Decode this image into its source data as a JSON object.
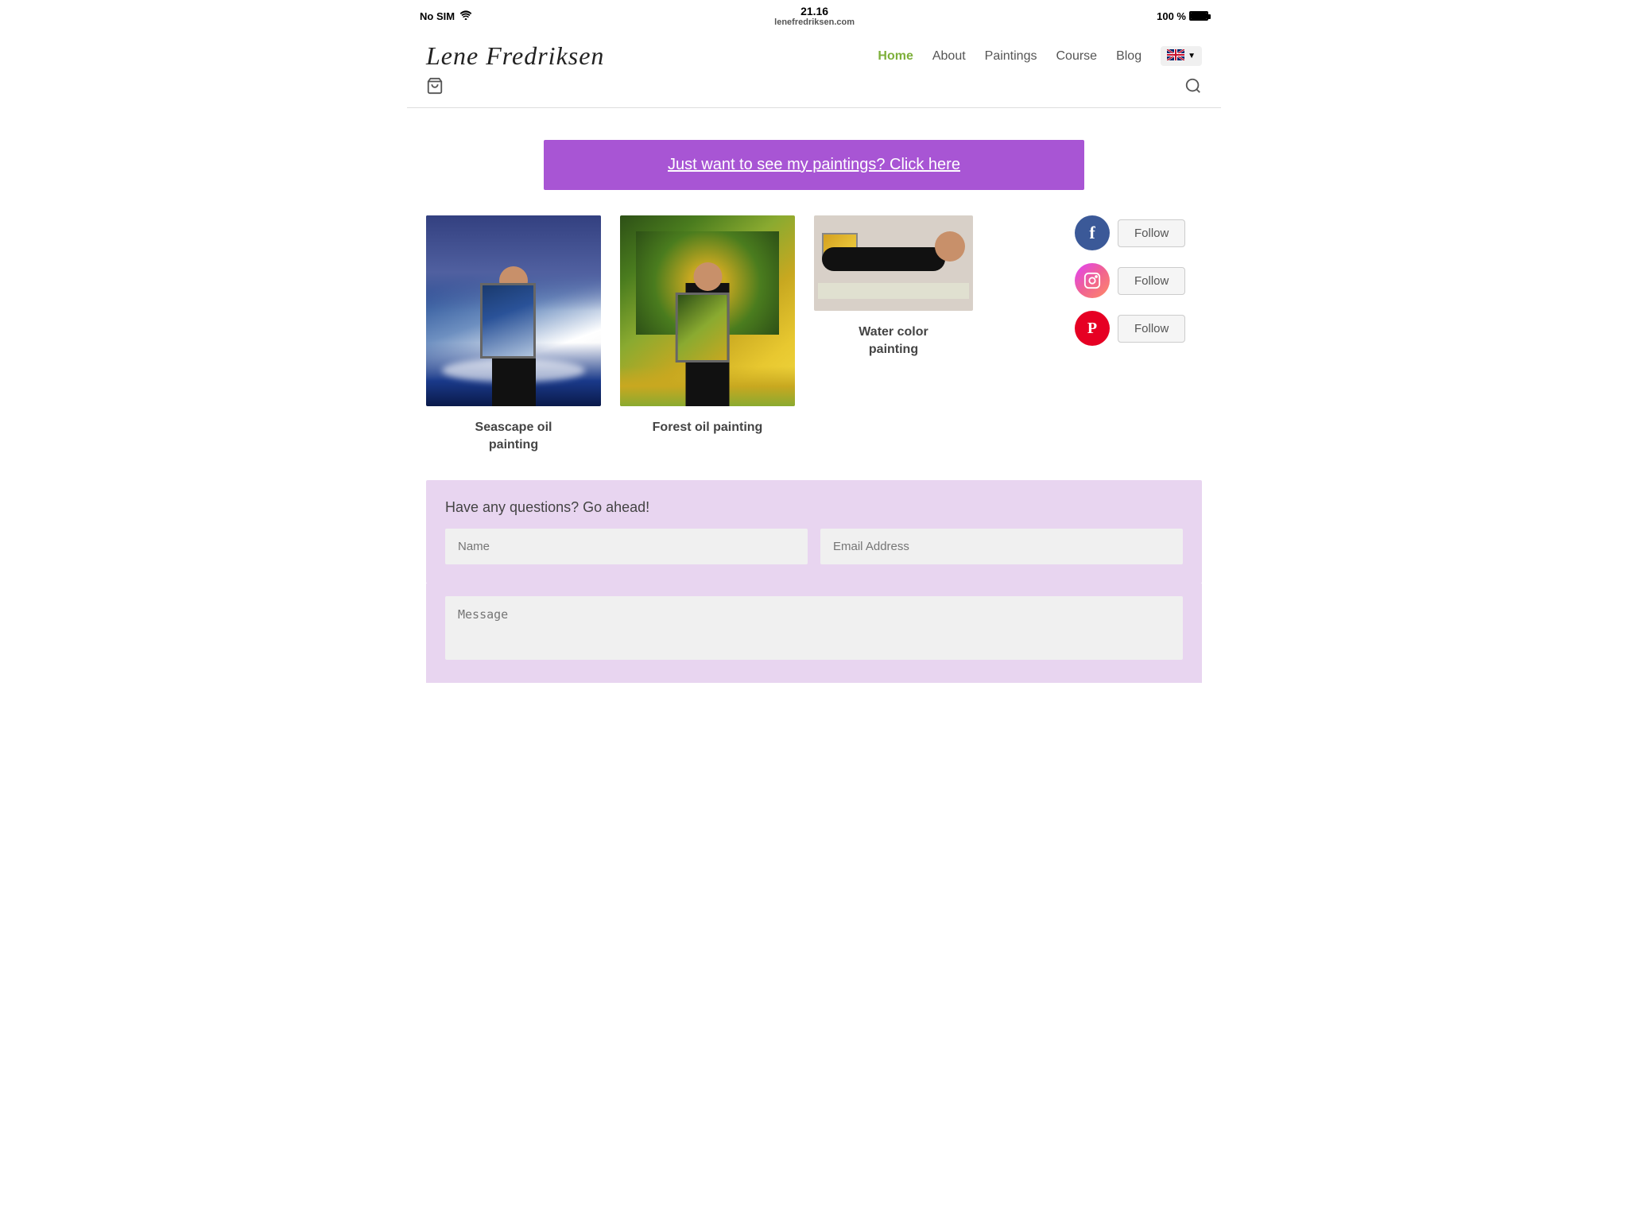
{
  "statusBar": {
    "carrier": "No SIM",
    "time": "21.16",
    "url": "lenefredriksen.com",
    "battery": "100 %"
  },
  "header": {
    "logo": "Lene Fredriksen",
    "nav": {
      "home": "Home",
      "about": "About",
      "paintings": "Paintings",
      "course": "Course",
      "blog": "Blog",
      "lang": "EN"
    }
  },
  "cta": {
    "label": "Just want to see my paintings? Click here"
  },
  "paintings": [
    {
      "id": "seascape",
      "label": "Seascape oil\npainting"
    },
    {
      "id": "forest",
      "label": "Forest oil painting"
    },
    {
      "id": "watercolor",
      "label": "Water color\npainting"
    }
  ],
  "social": {
    "facebook": {
      "follow_label": "Follow",
      "icon": "f"
    },
    "instagram": {
      "follow_label": "Follow",
      "icon": "📷"
    },
    "pinterest": {
      "follow_label": "Follow",
      "icon": "P"
    }
  },
  "contact": {
    "title": "Have any questions? Go ahead!",
    "name_placeholder": "Name",
    "email_placeholder": "Email Address",
    "message_placeholder": "Message"
  }
}
